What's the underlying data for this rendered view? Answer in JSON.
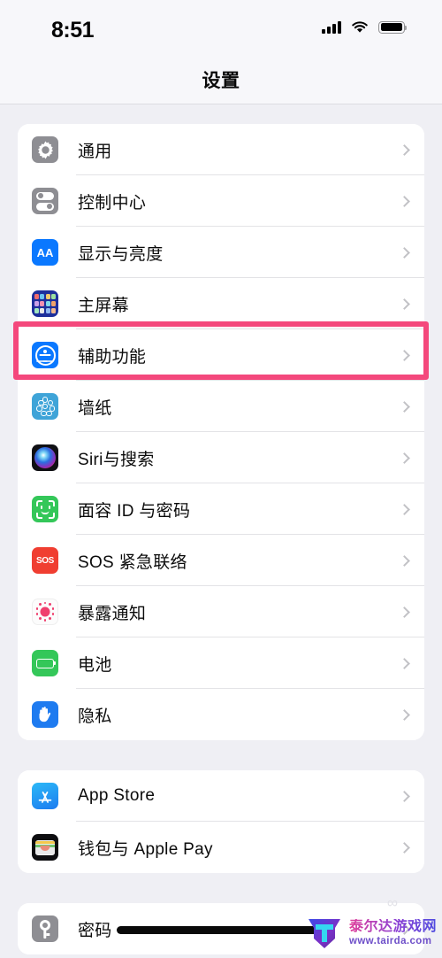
{
  "status_bar": {
    "time": "8:51",
    "signal_icon": "cellular-bars-icon",
    "wifi_icon": "wifi-icon",
    "battery_icon": "battery-full-icon"
  },
  "header": {
    "title": "设置"
  },
  "groups": [
    {
      "id": "group-system",
      "rows": [
        {
          "id": "general",
          "label": "通用",
          "icon": "gear-icon",
          "icon_class": "ic-general",
          "highlighted": false
        },
        {
          "id": "control-center",
          "label": "控制中心",
          "icon": "toggles-icon",
          "icon_class": "ic-control",
          "highlighted": false
        },
        {
          "id": "display",
          "label": "显示与亮度",
          "icon": "text-size-aa-icon",
          "icon_class": "ic-display",
          "highlighted": false
        },
        {
          "id": "home-screen",
          "label": "主屏幕",
          "icon": "app-grid-icon",
          "icon_class": "ic-home",
          "highlighted": false
        },
        {
          "id": "accessibility",
          "label": "辅助功能",
          "icon": "accessibility-icon",
          "icon_class": "ic-access",
          "highlighted": true
        },
        {
          "id": "wallpaper",
          "label": "墙纸",
          "icon": "flower-icon",
          "icon_class": "ic-wallpaper",
          "highlighted": false
        },
        {
          "id": "siri",
          "label": "Siri与搜索",
          "icon": "siri-orb-icon",
          "icon_class": "ic-siri",
          "highlighted": false
        },
        {
          "id": "faceid",
          "label": "面容 ID 与密码",
          "icon": "face-id-icon",
          "icon_class": "ic-faceid",
          "highlighted": false
        },
        {
          "id": "sos",
          "label": "SOS 紧急联络",
          "icon": "sos-icon",
          "icon_class": "ic-sos",
          "highlighted": false
        },
        {
          "id": "exposure",
          "label": "暴露通知",
          "icon": "exposure-notification-icon",
          "icon_class": "ic-exposure",
          "highlighted": false
        },
        {
          "id": "battery",
          "label": "电池",
          "icon": "battery-icon",
          "icon_class": "ic-battery",
          "highlighted": false
        },
        {
          "id": "privacy",
          "label": "隐私",
          "icon": "hand-privacy-icon",
          "icon_class": "ic-privacy",
          "highlighted": false
        }
      ]
    },
    {
      "id": "group-store",
      "rows": [
        {
          "id": "app-store",
          "label": "App Store",
          "icon": "app-store-icon",
          "icon_class": "ic-appstore",
          "highlighted": false
        },
        {
          "id": "wallet",
          "label": "钱包与 Apple Pay",
          "icon": "wallet-icon",
          "icon_class": "ic-wallet",
          "highlighted": false
        }
      ]
    },
    {
      "id": "group-accounts",
      "rows": [
        {
          "id": "passwords",
          "label": "密码",
          "icon": "key-icon",
          "icon_class": "ic-passwords",
          "highlighted": false
        }
      ]
    }
  ],
  "sos_text": "SOS",
  "display_icon_text": "AA",
  "highlight": {
    "target_row": "accessibility",
    "color": "#F4487C"
  },
  "watermark": {
    "site_name": "泰尔达游戏网",
    "url": "www.tairda.com",
    "logo_letter": "T"
  },
  "home_indicator": "home-indicator-bar"
}
